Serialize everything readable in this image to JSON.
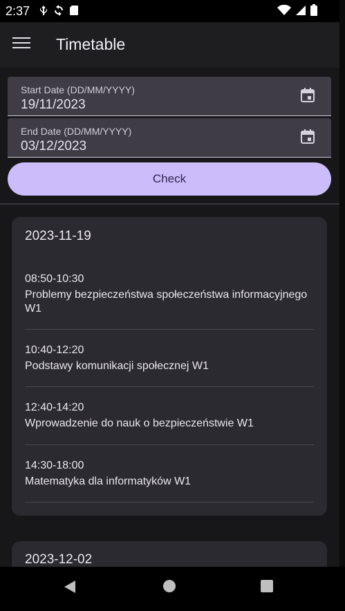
{
  "status_bar": {
    "time": "2:37",
    "left_icons": [
      "usb-icon",
      "sync-icon",
      "sd-card-icon"
    ],
    "right_icons": [
      "wifi-icon",
      "signal-icon",
      "battery-icon"
    ]
  },
  "app_bar": {
    "title": "Timetable",
    "menu_icon": "menu-icon"
  },
  "form": {
    "start_date": {
      "label": "Start Date (DD/MM/YYYY)",
      "value": "19/11/2023",
      "icon": "calendar-icon"
    },
    "end_date": {
      "label": "End Date (DD/MM/YYYY)",
      "value": "03/12/2023",
      "icon": "calendar-icon"
    },
    "check_label": "Check"
  },
  "days": [
    {
      "date": "2023-11-19",
      "classes": [
        {
          "time": "08:50-10:30",
          "name": "Problemy bezpieczeństwa społeczeństwa informacyjnego W1"
        },
        {
          "time": "10:40-12:20",
          "name": "Podstawy komunikacji społecznej W1"
        },
        {
          "time": "12:40-14:20",
          "name": "Wprowadzenie do nauk o bezpieczeństwie W1"
        },
        {
          "time": "14:30-18:00",
          "name": "Matematyka dla informatyków W1"
        }
      ]
    },
    {
      "date": "2023-12-02",
      "classes": []
    }
  ],
  "colors": {
    "accent": "#cdbcfa",
    "surface": "#2b2a30",
    "background": "#171719",
    "app_bar": "#1e1e21"
  }
}
